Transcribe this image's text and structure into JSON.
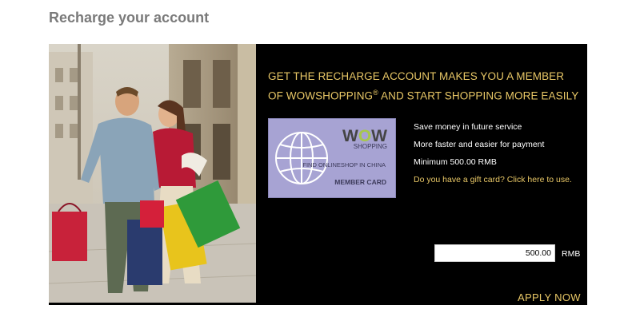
{
  "page": {
    "title": "Recharge your account"
  },
  "banner": {
    "headline_line1": "GET THE RECHARGE ACCOUNT MAKES YOU A MEMBER",
    "headline_line2_pre": "OF WOWSHOPPING",
    "headline_reg": "®",
    "headline_line2_post": " AND START SHOPPING MORE EASILY"
  },
  "card": {
    "logo_w1": "W",
    "logo_o": "O",
    "logo_w2": "W",
    "logo_sub": "SHOPPING",
    "tagline": "FIND ONLINESHOP IN CHINA",
    "label": "MEMBER CARD"
  },
  "benefits": [
    "Save money in future service",
    "More faster and easier for payment",
    "Minimum 500.00 RMB"
  ],
  "gift_card_link": "Do you have a gift card? Click here to use.",
  "amount": {
    "value": "500.00",
    "unit": "RMB"
  },
  "apply_button": "APPLY NOW",
  "colors": {
    "accent": "#e8c766",
    "banner_bg": "#000000",
    "card_bg": "#a7a3d3",
    "title": "#7a7a7a"
  }
}
